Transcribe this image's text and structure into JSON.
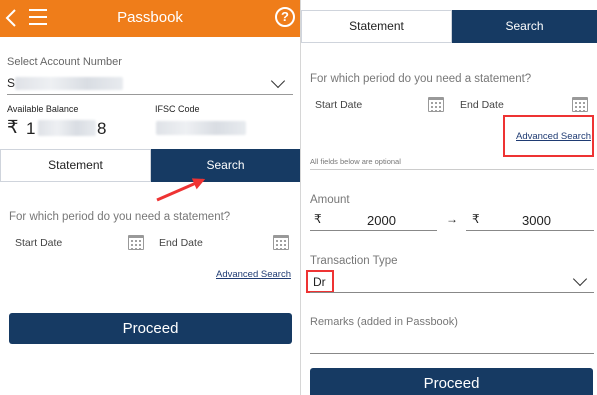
{
  "left": {
    "appbar": {
      "title": "Passbook",
      "help": "?"
    },
    "account": {
      "label": "Select Account Number",
      "value_prefix": "S"
    },
    "balance": {
      "label": "Available Balance",
      "currency": "₹",
      "value_visible_start": "1",
      "value_visible_end": "8"
    },
    "ifsc": {
      "label": "IFSC Code"
    },
    "tabs": {
      "statement": "Statement",
      "search": "Search"
    },
    "question": "For which period do you need a statement?",
    "start_date": "Start Date",
    "end_date": "End Date",
    "advanced_search": "Advanced Search",
    "proceed": "Proceed"
  },
  "right": {
    "tabs": {
      "statement": "Statement",
      "search": "Search"
    },
    "question": "For which period do you need a statement?",
    "start_date": "Start Date",
    "end_date": "End Date",
    "advanced_search": "Advanced Search",
    "optional_note": "All fields below are optional",
    "amount": {
      "label": "Amount",
      "currency": "₹",
      "from": "2000",
      "to": "3000",
      "arrow": "→"
    },
    "transaction_type": {
      "label": "Transaction Type",
      "value": "Dr"
    },
    "remarks": {
      "label": "Remarks (added in Passbook)"
    },
    "proceed": "Proceed"
  },
  "colors": {
    "orange": "#ef7d1a",
    "navy": "#163a63",
    "highlight": "#e33333"
  }
}
